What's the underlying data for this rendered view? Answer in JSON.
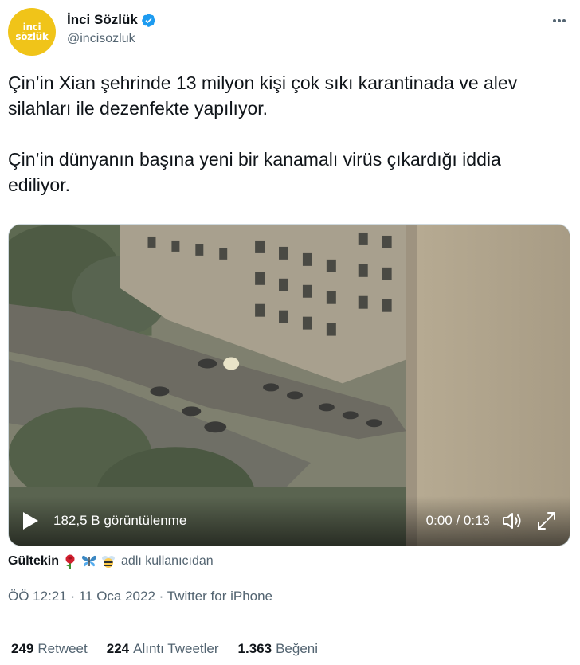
{
  "account": {
    "logo_line1": "inci",
    "logo_line2": "sözlük",
    "display_name": "İnci Sözlük",
    "handle": "@incisozluk",
    "verified": true
  },
  "tweet": {
    "text": "Çin’in Xian şehrinde 13 milyon kişi çok sıkı karantinada ve alev silahları ile dezenfekte yapılıyor.\n\nÇin’in dünyanın başına yeni bir kanamalı virüs çıkardığı iddia ediliyor."
  },
  "video": {
    "views": "182,5 B görüntülenme",
    "time": "0:00 / 0:13"
  },
  "attribution": {
    "name": "Gültekin",
    "emojis": [
      "rose",
      "butterfly",
      "bee"
    ],
    "suffix": "adlı kullanıcıdan"
  },
  "meta": {
    "time": "ÖÖ 12:21",
    "separator1": " · ",
    "date": "11 Oca 2022",
    "separator2": " · ",
    "source": "Twitter for iPhone"
  },
  "stats": [
    {
      "count": "249",
      "label": "Retweet"
    },
    {
      "count": "224",
      "label": "Alıntı Tweetler"
    },
    {
      "count": "1.363",
      "label": "Beğeni"
    }
  ],
  "colors": {
    "text": "#0f1419",
    "secondary": "#536471",
    "verified": "#1d9bf0",
    "avatar_bg": "#f0c419"
  }
}
